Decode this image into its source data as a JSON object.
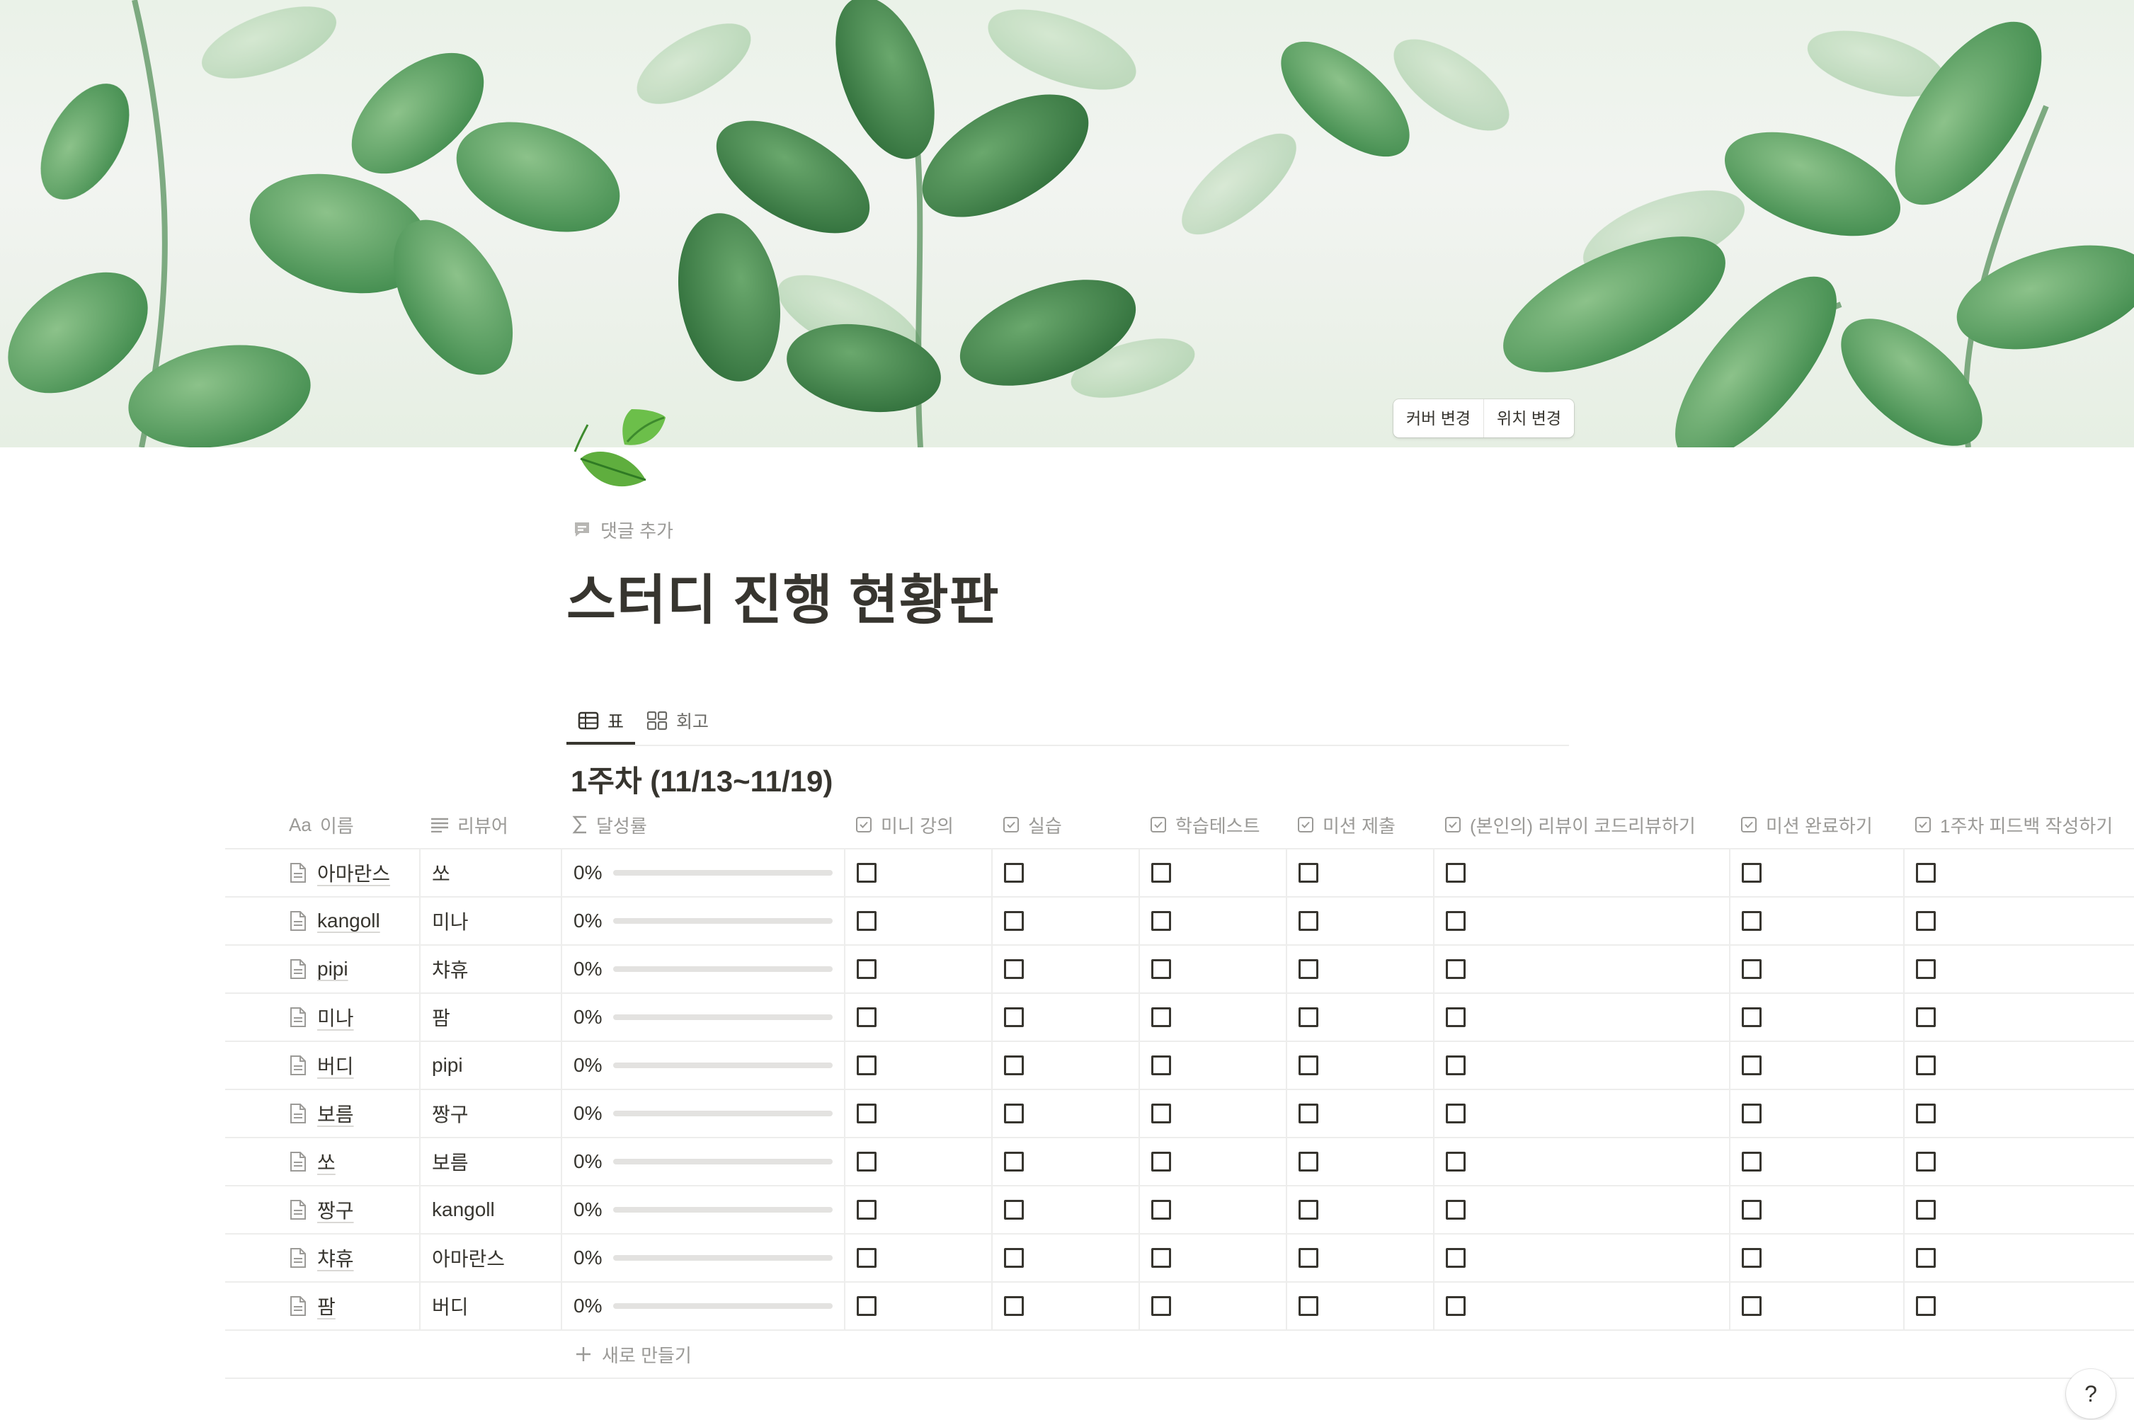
{
  "cover": {
    "change_cover_label": "커버 변경",
    "reposition_label": "위치 변경"
  },
  "page": {
    "icon": "leaf-fluttering-icon",
    "add_comment_label": "댓글 추가",
    "title": "스터디 진행 현황판"
  },
  "views": {
    "tabs": [
      {
        "label": "표",
        "icon": "table-icon",
        "active": true
      },
      {
        "label": "회고",
        "icon": "gallery-icon",
        "active": false
      }
    ]
  },
  "group": {
    "title": "1주차 (11/13~11/19)"
  },
  "table": {
    "columns": [
      {
        "label": "이름",
        "icon": "title-icon"
      },
      {
        "label": "리뷰어",
        "icon": "text-icon"
      },
      {
        "label": "달성률",
        "icon": "formula-icon"
      },
      {
        "label": "미니 강의",
        "icon": "checkbox-icon"
      },
      {
        "label": "실습",
        "icon": "checkbox-icon"
      },
      {
        "label": "학습테스트",
        "icon": "checkbox-icon"
      },
      {
        "label": "미션 제출",
        "icon": "checkbox-icon"
      },
      {
        "label": "(본인의) 리뷰이 코드리뷰하기",
        "icon": "checkbox-icon"
      },
      {
        "label": "미션 완료하기",
        "icon": "checkbox-icon"
      },
      {
        "label": "1주차 피드백 작성하기",
        "icon": "checkbox-icon"
      }
    ],
    "title_column_icon_text": "Aa",
    "rows": [
      {
        "name": "아마란스",
        "reviewer": "쏘",
        "progress": "0%",
        "progress_value": 0,
        "checks": [
          false,
          false,
          false,
          false,
          false,
          false,
          false
        ]
      },
      {
        "name": "kangoll",
        "reviewer": "미나",
        "progress": "0%",
        "progress_value": 0,
        "checks": [
          false,
          false,
          false,
          false,
          false,
          false,
          false
        ]
      },
      {
        "name": "pipi",
        "reviewer": "챠휴",
        "progress": "0%",
        "progress_value": 0,
        "checks": [
          false,
          false,
          false,
          false,
          false,
          false,
          false
        ]
      },
      {
        "name": "미나",
        "reviewer": "팜",
        "progress": "0%",
        "progress_value": 0,
        "checks": [
          false,
          false,
          false,
          false,
          false,
          false,
          false
        ]
      },
      {
        "name": "버디",
        "reviewer": "pipi",
        "progress": "0%",
        "progress_value": 0,
        "checks": [
          false,
          false,
          false,
          false,
          false,
          false,
          false
        ]
      },
      {
        "name": "보름",
        "reviewer": "짱구",
        "progress": "0%",
        "progress_value": 0,
        "checks": [
          false,
          false,
          false,
          false,
          false,
          false,
          false
        ]
      },
      {
        "name": "쏘",
        "reviewer": "보름",
        "progress": "0%",
        "progress_value": 0,
        "checks": [
          false,
          false,
          false,
          false,
          false,
          false,
          false
        ]
      },
      {
        "name": "짱구",
        "reviewer": "kangoll",
        "progress": "0%",
        "progress_value": 0,
        "checks": [
          false,
          false,
          false,
          false,
          false,
          false,
          false
        ]
      },
      {
        "name": "챠휴",
        "reviewer": "아마란스",
        "progress": "0%",
        "progress_value": 0,
        "checks": [
          false,
          false,
          false,
          false,
          false,
          false,
          false
        ]
      },
      {
        "name": "팜",
        "reviewer": "버디",
        "progress": "0%",
        "progress_value": 0,
        "checks": [
          false,
          false,
          false,
          false,
          false,
          false,
          false
        ]
      }
    ],
    "new_row_label": "새로 만들기"
  },
  "help": {
    "label": "?"
  },
  "colors": {
    "text": "#37352f",
    "muted": "#9b9a97",
    "border": "#ededec",
    "progress_track": "#e3e2e0"
  }
}
